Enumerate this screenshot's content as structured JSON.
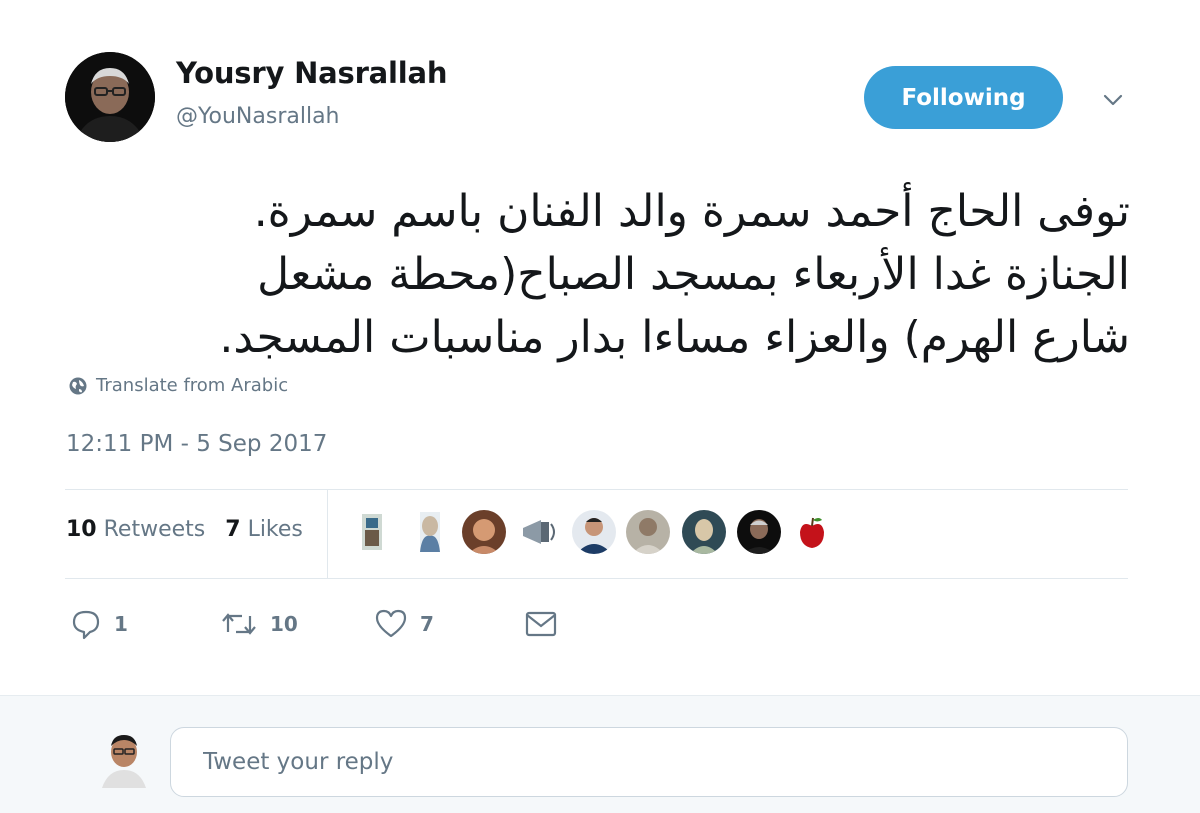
{
  "author": {
    "name": "Yousry Nasrallah",
    "handle": "@YouNasrallah"
  },
  "follow_button": {
    "label": "Following",
    "color": "#3a9fd7"
  },
  "tweet": {
    "lines": [
      "توفى الحاج أحمد سمرة والد الفنان باسم سمرة.",
      "الجنازة غدا الأربعاء بمسجد الصباح(محطة مشعل",
      "شارع الهرم) والعزاء مساءا بدار مناسبات المسجد."
    ],
    "translate_label": "Translate from Arabic",
    "timestamp": "12:11 PM - 5 Sep 2017"
  },
  "stats": {
    "retweets_count": "10",
    "retweets_label": "Retweets",
    "likes_count": "7",
    "likes_label": "Likes"
  },
  "actions": {
    "reply_count": "1",
    "retweet_count": "10",
    "like_count": "7"
  },
  "reply": {
    "placeholder": "Tweet your reply"
  },
  "colors": {
    "text_primary": "#14171a",
    "text_secondary": "#657786",
    "border": "#e1e8ed",
    "reply_bg": "#f5f8fa"
  }
}
